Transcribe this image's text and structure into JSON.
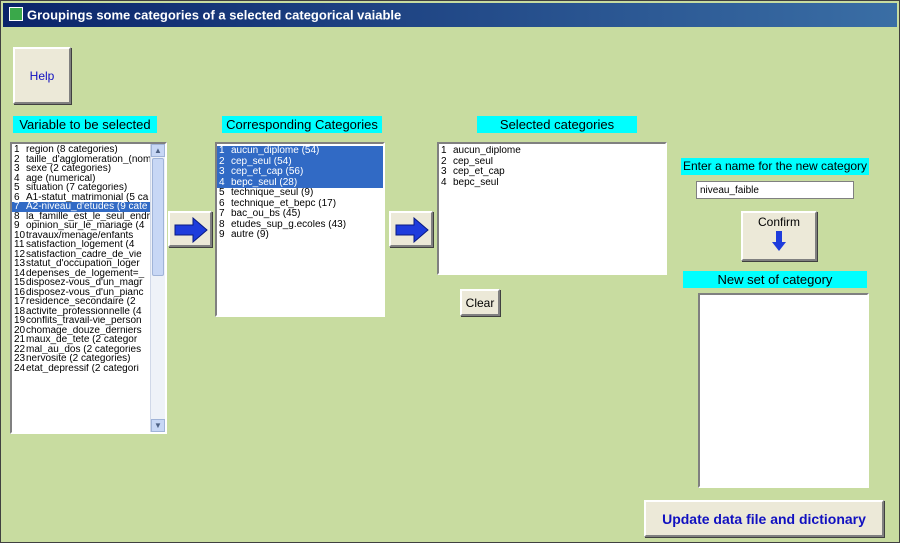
{
  "window": {
    "title": "Groupings some categories of a selected categorical vaiable"
  },
  "help_button": "Help",
  "variables": {
    "label": "Variable to be selected",
    "items": [
      {
        "num": "1",
        "text": "region (8 categories)"
      },
      {
        "num": "2",
        "text": "taille_d'agglomeration_(nom"
      },
      {
        "num": "3",
        "text": "sexe (2 categories)"
      },
      {
        "num": "4",
        "text": "age (numerical)"
      },
      {
        "num": "5",
        "text": "situation (7 categories)"
      },
      {
        "num": "6",
        "text": "A1-statut_matrimonial (5 ca"
      },
      {
        "num": "7",
        "text": "A2-niveau_d'etudes (9 cate"
      },
      {
        "num": "8",
        "text": "la_famille_est_le_seul_endr"
      },
      {
        "num": "9",
        "text": "opinion_sur_le_mariage  (4"
      },
      {
        "num": "10",
        "text": "travaux/menage/enfants"
      },
      {
        "num": "11",
        "text": "satisfaction_logement  (4"
      },
      {
        "num": "12",
        "text": "satisfaction_cadre_de_vie"
      },
      {
        "num": "13",
        "text": "statut_d'occupation_loger"
      },
      {
        "num": "14",
        "text": "depenses_de_logement=_"
      },
      {
        "num": "15",
        "text": "disposez-vous_d'un_magr"
      },
      {
        "num": "16",
        "text": "disposez-vous_d'un_pianc"
      },
      {
        "num": "17",
        "text": "residence_secondaire  (2"
      },
      {
        "num": "18",
        "text": "activite_professionnelle  (4"
      },
      {
        "num": "19",
        "text": "conflits_travail-vie_person"
      },
      {
        "num": "20",
        "text": "chomage_douze_derniers"
      },
      {
        "num": "21",
        "text": "maux_de_tete  (2 categor"
      },
      {
        "num": "22",
        "text": "mal_au_dos  (2 categories"
      },
      {
        "num": "23",
        "text": "nervosite  (2 categories)"
      },
      {
        "num": "24",
        "text": "etat_depressif  (2 categori"
      }
    ]
  },
  "corresponding": {
    "label": "Corresponding Categories",
    "items": [
      {
        "num": "1",
        "text": "aucun_diplome     (54)"
      },
      {
        "num": "2",
        "text": "cep_seul    (54)"
      },
      {
        "num": "3",
        "text": "cep_et_cap      (56)"
      },
      {
        "num": "4",
        "text": "bepc_seul      (28)"
      },
      {
        "num": "5",
        "text": "technique_seul    (9)"
      },
      {
        "num": "6",
        "text": "technique_et_bepc      (17)"
      },
      {
        "num": "7",
        "text": "bac_ou_bs      (45)"
      },
      {
        "num": "8",
        "text": "etudes_sup_g.ecoles     (43)"
      },
      {
        "num": "9",
        "text": "autre    (9)"
      }
    ]
  },
  "selected": {
    "label": "Selected categories",
    "items": [
      {
        "num": "1",
        "text": "aucun_diplome"
      },
      {
        "num": "2",
        "text": "cep_seul"
      },
      {
        "num": "3",
        "text": "cep_et_cap"
      },
      {
        "num": "4",
        "text": "bepc_seul"
      }
    ]
  },
  "clear_button": "Clear",
  "new_name": {
    "label": "Enter a name for the new category",
    "value": "niveau_faible"
  },
  "confirm_button": "Confirm",
  "new_set_label": "New set of category",
  "update_button": "Update data file and dictionary",
  "colors": {
    "background": "#c8dca0",
    "label_bg": "#00ffff",
    "selection": "#316ac5",
    "arrow": "#1e3cdc"
  }
}
